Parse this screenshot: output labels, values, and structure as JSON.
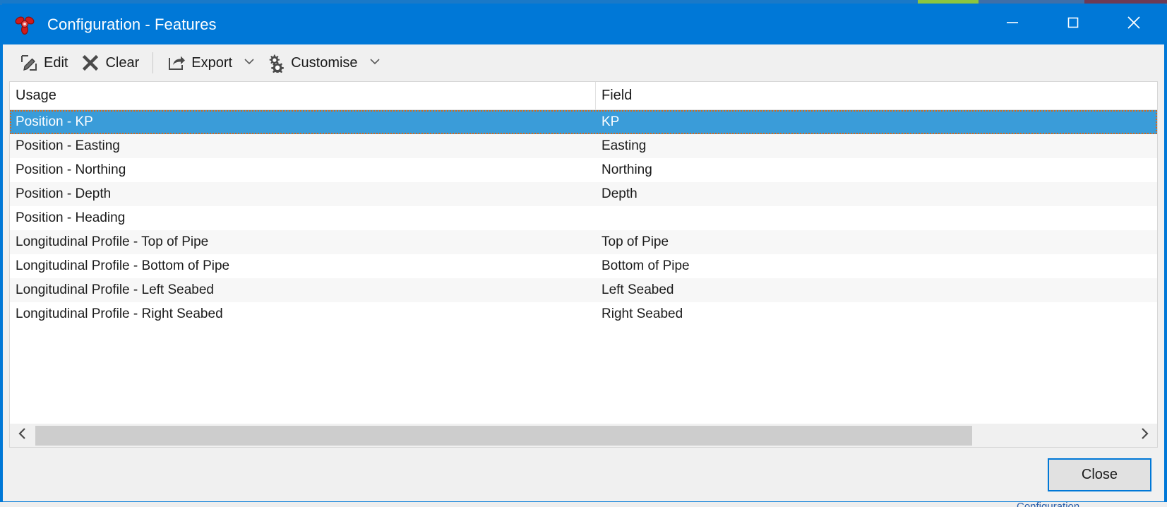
{
  "window": {
    "title": "Configuration - Features",
    "app_icon": "trefoil-propeller-icon",
    "controls": {
      "minimize": "minimize-icon",
      "maximize": "maximize-icon",
      "close": "close-icon"
    }
  },
  "toolbar": {
    "edit_label": "Edit",
    "clear_label": "Clear",
    "export_label": "Export",
    "customise_label": "Customise"
  },
  "table": {
    "columns": [
      "Usage",
      "Field"
    ],
    "rows": [
      {
        "usage": "Position - KP",
        "field": "KP",
        "selected": true
      },
      {
        "usage": "Position - Easting",
        "field": "Easting",
        "selected": false
      },
      {
        "usage": "Position - Northing",
        "field": "Northing",
        "selected": false
      },
      {
        "usage": "Position - Depth",
        "field": "Depth",
        "selected": false
      },
      {
        "usage": "Position - Heading",
        "field": "",
        "selected": false
      },
      {
        "usage": "Longitudinal Profile - Top of Pipe",
        "field": "Top of Pipe",
        "selected": false
      },
      {
        "usage": "Longitudinal Profile - Bottom of Pipe",
        "field": "Bottom of Pipe",
        "selected": false
      },
      {
        "usage": "Longitudinal Profile - Left Seabed",
        "field": "Left Seabed",
        "selected": false
      },
      {
        "usage": "Longitudinal Profile - Right Seabed",
        "field": "Right Seabed",
        "selected": false
      }
    ]
  },
  "scrollbar": {
    "left_arrow": "chevron-left-icon",
    "right_arrow": "chevron-right-icon"
  },
  "footer": {
    "close_label": "Close"
  },
  "colors": {
    "titlebar": "#0078d7",
    "selection": "#3a9cd9",
    "focus_border": "#d2691e",
    "accent": "#0078d7",
    "toolbar_bg": "#f0f0f0",
    "row_alt": "#f7f7f7"
  },
  "background": {
    "bottom_text": "Configuration"
  }
}
